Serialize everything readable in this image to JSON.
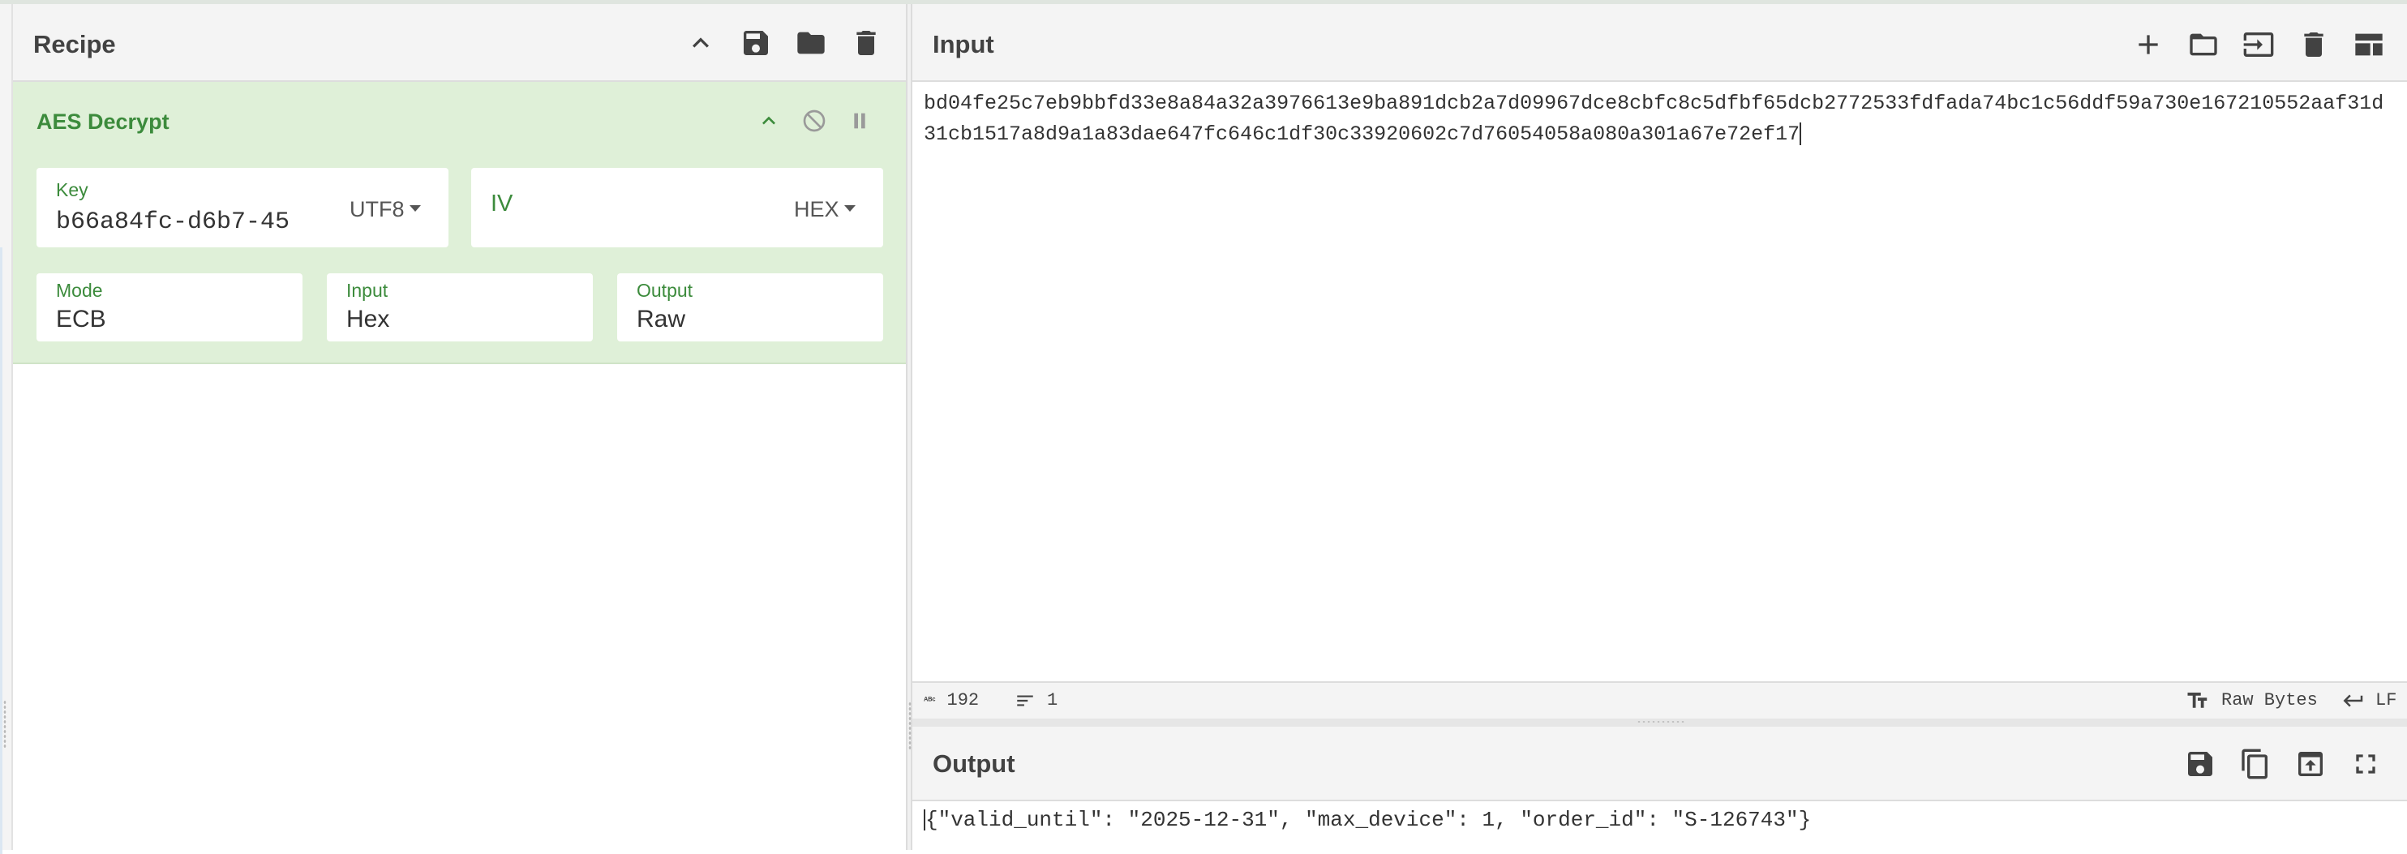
{
  "recipe": {
    "title": "Recipe",
    "operation": {
      "name": "AES Decrypt",
      "key": {
        "label": "Key",
        "value": "b66a84fc-d6b7-45",
        "encoding": "UTF8"
      },
      "iv": {
        "label": "IV",
        "value": "",
        "encoding": "HEX"
      },
      "mode": {
        "label": "Mode",
        "value": "ECB"
      },
      "input": {
        "label": "Input",
        "value": "Hex"
      },
      "output": {
        "label": "Output",
        "value": "Raw"
      }
    }
  },
  "input": {
    "title": "Input",
    "text": "bd04fe25c7eb9bbfd33e8a84a32a3976613e9ba891dcb2a7d09967dce8cbfc8c5dfbf65dcb2772533fdfada74bc1c56ddf59a730e167210552aaf31d31cb1517a8d9a1a83dae647fc646c1df30c33920602c7d76054058a080a301a67e72ef17"
  },
  "status": {
    "length": "192",
    "lines": "1",
    "encoding": "Raw Bytes",
    "eol": "LF"
  },
  "output": {
    "title": "Output",
    "text": "{\"valid_until\": \"2025-12-31\", \"max_device\": 1, \"order_id\": \"S-126743\"}"
  }
}
